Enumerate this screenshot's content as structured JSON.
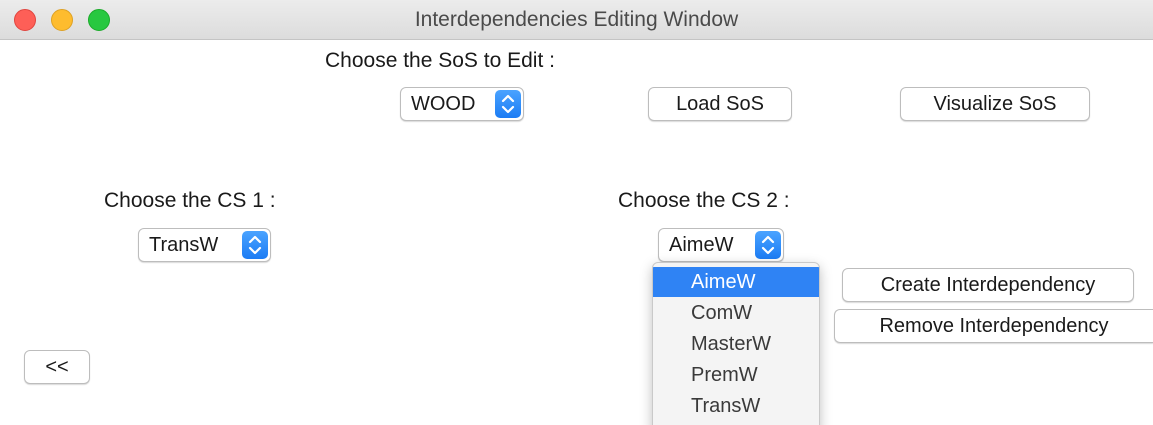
{
  "window": {
    "title": "Interdependencies Editing Window"
  },
  "sos": {
    "label": "Choose the SoS to Edit :",
    "selected": "WOOD",
    "load_label": "Load SoS",
    "visualize_label": "Visualize SoS"
  },
  "cs1": {
    "label": "Choose the CS 1 :",
    "selected": "TransW"
  },
  "cs2": {
    "label": "Choose the CS 2 :",
    "selected": "AimeW",
    "options": [
      "AimeW",
      "ComW",
      "MasterW",
      "PremW",
      "TransW"
    ]
  },
  "actions": {
    "create_label": "Create Interdependency",
    "remove_label": "Remove Interdependency",
    "back_label": "<<"
  },
  "colors": {
    "accent": "#2f83f4",
    "close": "#fe5f57",
    "minimize": "#febc2e",
    "maximize": "#28c840"
  },
  "icons": {
    "stepper": "up-down-chevron-icon"
  }
}
